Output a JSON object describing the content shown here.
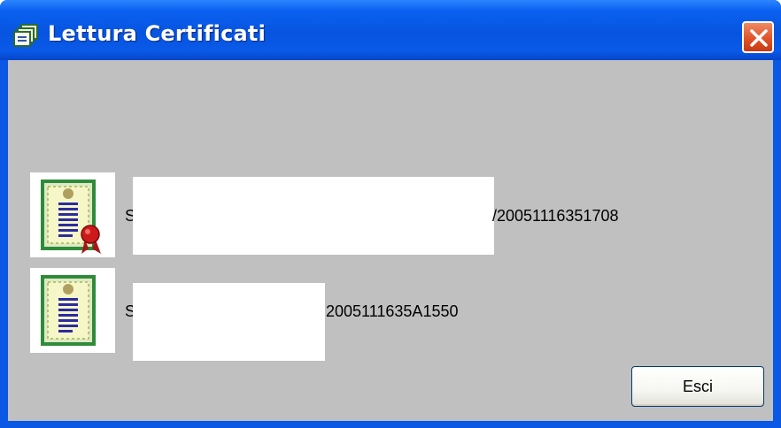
{
  "window": {
    "title": "Lettura Certificati",
    "title_icon": "certificates-app-icon",
    "close_icon": "close-icon"
  },
  "certificates": [
    {
      "icon": "certificate-with-seal-icon",
      "prefix": "S",
      "suffix": "/20051116351708"
    },
    {
      "icon": "certificate-icon",
      "prefix": "S",
      "suffix": "2005111635A1550"
    }
  ],
  "buttons": {
    "exit_label": "Esci"
  },
  "colors": {
    "titlebar": "#0a58e3",
    "client_background": "#c0c0c0",
    "close_button": "#e0542a",
    "certificate_frame": "#2e8b3a",
    "seal": "#cc1a1a"
  }
}
